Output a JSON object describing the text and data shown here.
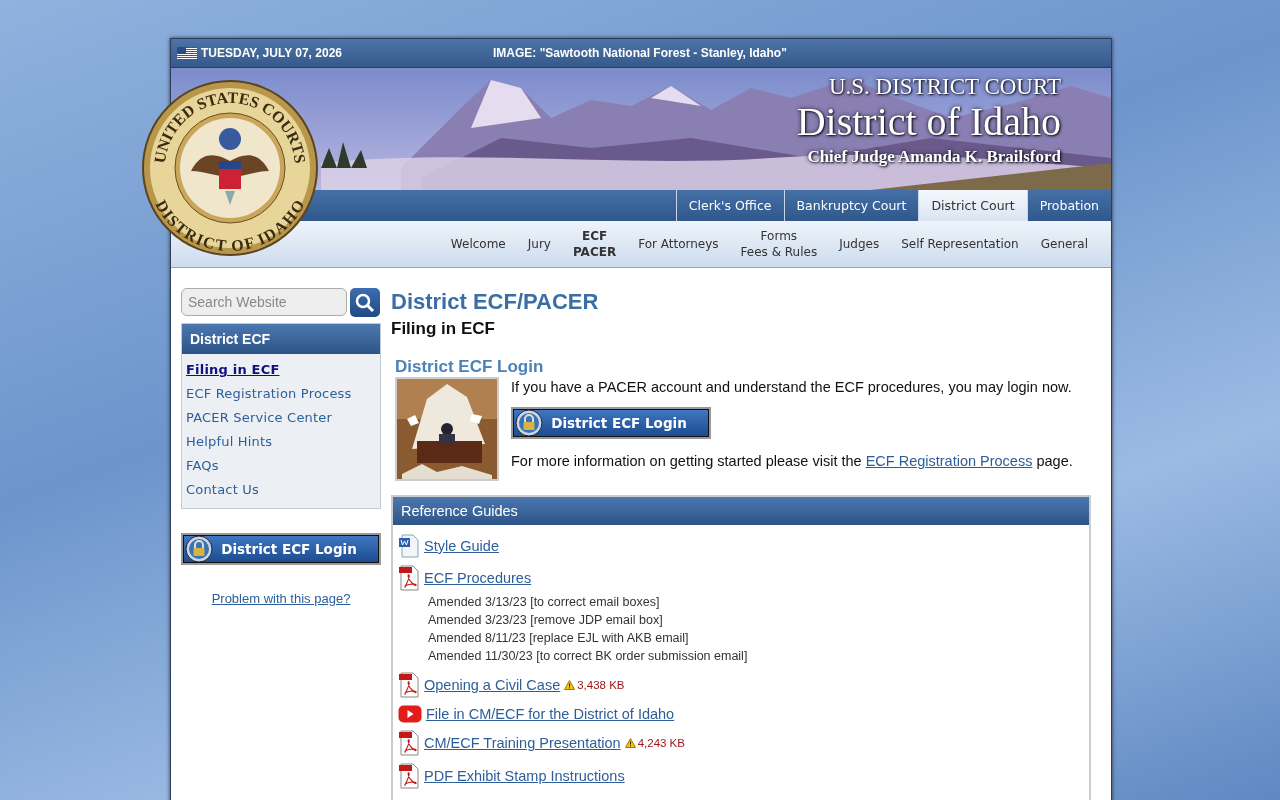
{
  "top_bar": {
    "date": "TUESDAY, JULY 07, 2026",
    "image_caption": "IMAGE: \"Sawtooth National Forest - Stanley, Idaho\""
  },
  "seal": {
    "top_text": "UNITED STATES COURTS",
    "bottom_text": "DISTRICT OF IDAHO"
  },
  "header": {
    "overline": "U.S. DISTRICT COURT",
    "title": "District of Idaho",
    "subtitle": "Chief Judge Amanda K. Brailsford"
  },
  "court_tabs": [
    {
      "label": "Clerk's Office",
      "selected": false
    },
    {
      "label": "Bankruptcy Court",
      "selected": false
    },
    {
      "label": "District Court",
      "selected": true
    },
    {
      "label": "Probation",
      "selected": false
    }
  ],
  "nav": [
    {
      "lines": [
        "Welcome"
      ],
      "selected": false
    },
    {
      "lines": [
        "Jury"
      ],
      "selected": false
    },
    {
      "lines": [
        "ECF",
        "PACER"
      ],
      "selected": true
    },
    {
      "lines": [
        "For Attorneys"
      ],
      "selected": false
    },
    {
      "lines": [
        "Forms",
        "Fees & Rules"
      ],
      "selected": false
    },
    {
      "lines": [
        "Judges"
      ],
      "selected": false
    },
    {
      "lines": [
        "Self Representation"
      ],
      "selected": false
    },
    {
      "lines": [
        "General"
      ],
      "selected": false
    }
  ],
  "sidebar": {
    "search": {
      "placeholder": "Search Website"
    },
    "menu_title": "District ECF",
    "items": [
      {
        "label": "Filing in ECF",
        "selected": true
      },
      {
        "label": "ECF Registration Process",
        "selected": false
      },
      {
        "label": "PACER Service Center",
        "selected": false
      },
      {
        "label": "Helpful Hints",
        "selected": false
      },
      {
        "label": "FAQs",
        "selected": false
      },
      {
        "label": "Contact Us",
        "selected": false
      }
    ],
    "login_button": "District ECF Login",
    "problem_link": "Problem with this page?"
  },
  "main": {
    "title": "District ECF/PACER",
    "subtitle": "Filing in ECF",
    "login_section": {
      "heading": "District ECF Login",
      "intro": "If you have a PACER account and understand the ECF procedures, you may login now.",
      "button": "District ECF Login",
      "more_before": "For more information on getting started please visit the",
      "more_link": "ECF Registration Process",
      "more_after": "page."
    },
    "reference": {
      "title": "Reference Guides",
      "items": [
        {
          "kind": "word",
          "label": "Style Guide"
        },
        {
          "kind": "pdf",
          "label": "ECF Procedures",
          "notes": [
            "Amended 3/13/23 [to correct email boxes]",
            "Amended 3/23/23 [remove JDP email box]",
            "Amended 8/11/23 [replace EJL with AKB email]",
            "Amended 11/30/23 [to correct BK order submission email]"
          ]
        },
        {
          "kind": "pdf",
          "label": "Opening a Civil Case",
          "size": "3,438 KB"
        },
        {
          "kind": "video",
          "label": "File in CM/ECF for the District of Idaho"
        },
        {
          "kind": "pdf",
          "label": "CM/ECF Training Presentation",
          "size": "4,243 KB"
        },
        {
          "kind": "pdf",
          "label": "PDF Exhibit Stamp Instructions"
        }
      ]
    }
  }
}
